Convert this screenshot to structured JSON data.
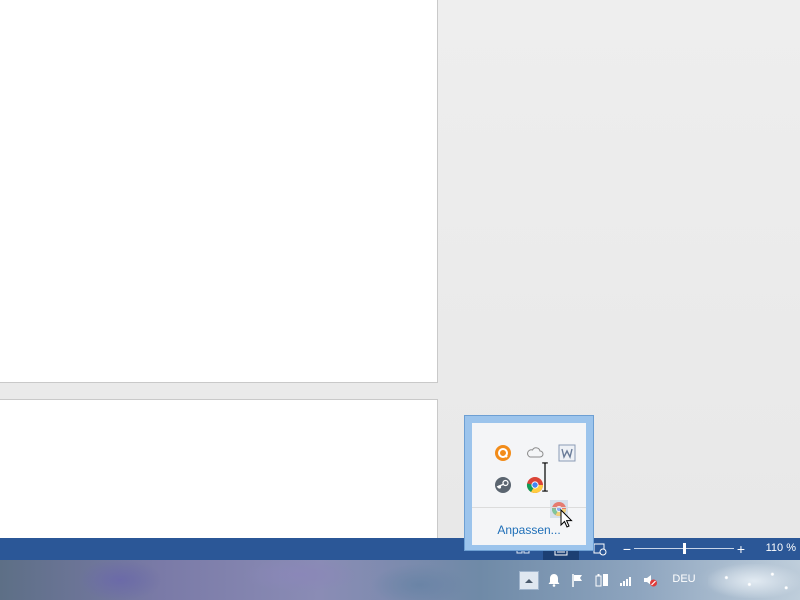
{
  "statusbar": {
    "zoom_minus": "−",
    "zoom_plus": "+",
    "zoom_level": "110 %",
    "zoom_fraction": 0.5
  },
  "tray_flyout": {
    "icons": [
      "avast-icon",
      "onedrive-cloud-icon",
      "word-icon",
      "steam-icon",
      "chrome-icon",
      "chrome-dragged-icon"
    ],
    "customize_label": "Anpassen..."
  },
  "taskbar": {
    "tray_icons": [
      "show-hidden-icons-chevron",
      "notification-bell-icon",
      "action-center-flag-icon",
      "power-battery-icon",
      "network-signal-icon",
      "speaker-muted-icon"
    ],
    "language": "DEU"
  },
  "colors": {
    "statusbar": "#2b5797",
    "flyout_border": "#9cc4ec",
    "link": "#1f6fb8"
  }
}
